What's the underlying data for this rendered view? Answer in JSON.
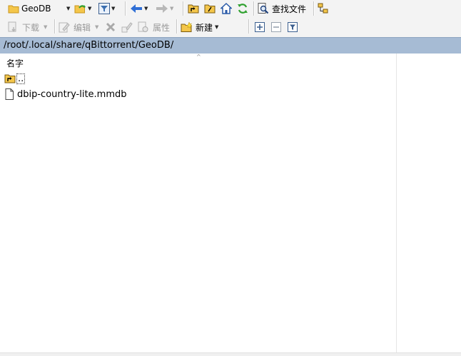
{
  "toolbar1": {
    "location_label": "GeoDB",
    "search_label": "查找文件"
  },
  "toolbar2": {
    "download_label": "下载",
    "edit_label": "编辑",
    "properties_label": "属性",
    "new_label": "新建"
  },
  "path": {
    "current": "/root/.local/share/qBittorrent/GeoDB/"
  },
  "list": {
    "column_name": "名字",
    "sort_indicator": "^",
    "items": [
      {
        "name": "..",
        "icon": "parent-folder-icon"
      },
      {
        "name": "dbip-country-lite.mmdb",
        "icon": "file-icon"
      }
    ]
  },
  "colors": {
    "path_bar": "#a6bbd4",
    "toolbar": "#f3f3f3",
    "folder": "#f4c64a",
    "refresh": "#2fa12f",
    "nav_arrow": "#2f6fd6"
  }
}
